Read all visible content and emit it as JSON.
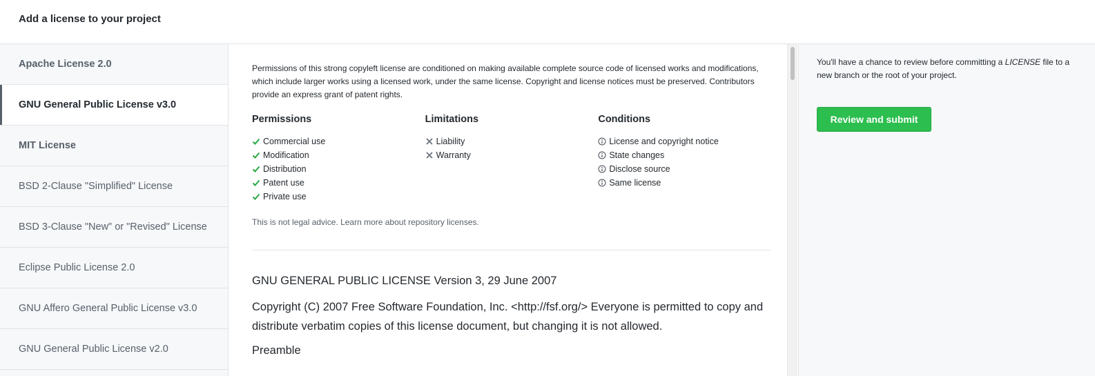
{
  "header": {
    "title": "Add a license to your project"
  },
  "sidebar": {
    "items": [
      {
        "label": "Apache License 2.0"
      },
      {
        "label": "GNU General Public License v3.0"
      },
      {
        "label": "MIT License"
      },
      {
        "label": "BSD 2-Clause \"Simplified\" License"
      },
      {
        "label": "BSD 3-Clause \"New\" or \"Revised\" License"
      },
      {
        "label": "Eclipse Public License 2.0"
      },
      {
        "label": "GNU Affero General Public License v3.0"
      },
      {
        "label": "GNU General Public License v2.0"
      }
    ]
  },
  "main": {
    "description": "Permissions of this strong copyleft license are conditioned on making available complete source code of licensed works and modifications, which include larger works using a licensed work, under the same license. Copyright and license notices must be preserved. Contributors provide an express grant of patent rights.",
    "permissions": {
      "title": "Permissions",
      "items": [
        "Commercial use",
        "Modification",
        "Distribution",
        "Patent use",
        "Private use"
      ]
    },
    "limitations": {
      "title": "Limitations",
      "items": [
        "Liability",
        "Warranty"
      ]
    },
    "conditions": {
      "title": "Conditions",
      "items": [
        "License and copyright notice",
        "State changes",
        "Disclose source",
        "Same license"
      ]
    },
    "disclaimer": "This is not legal advice. Learn more about repository licenses.",
    "license_heading": "GNU GENERAL PUBLIC LICENSE Version 3, 29 June 2007",
    "license_paragraph": "Copyright (C) 2007 Free Software Foundation, Inc. <http://fsf.org/> Everyone is permitted to copy and distribute verbatim copies of this license document, but changing it is not allowed.",
    "license_subheading": "Preamble"
  },
  "right": {
    "note_prefix": "You'll have a chance to review before committing a ",
    "note_file": "LICENSE",
    "note_suffix": " file to a new branch or the root of your project.",
    "button_label": "Review and submit"
  },
  "colors": {
    "check": "#28a745",
    "cross": "#6a737d",
    "button": "#2cbe4e"
  },
  "icons": {
    "permission": "check-icon",
    "limitation": "x-icon",
    "condition": "info-icon"
  }
}
